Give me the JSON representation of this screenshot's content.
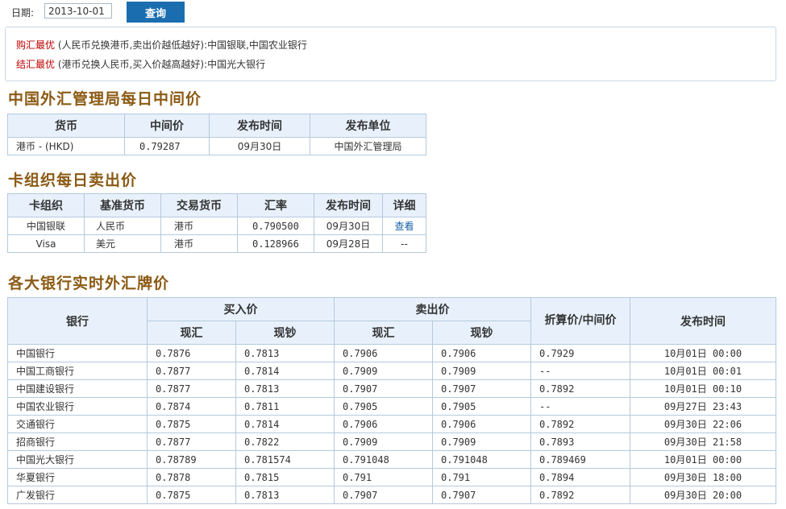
{
  "query": {
    "date_label": "日期:",
    "date_value": "2013-10-01",
    "button_label": "查询"
  },
  "best": {
    "buy_label": "购汇最优",
    "buy_text": "(人民币兑换港币,卖出价越低越好):中国银联,中国农业银行",
    "sell_label": "结汇最优",
    "sell_text": "(港币兑换人民币,买入价越高越好):中国光大银行"
  },
  "safe": {
    "title": "中国外汇管理局每日中间价",
    "headers": [
      "货币",
      "中间价",
      "发布时间",
      "发布单位"
    ],
    "row": [
      "港币 - (HKD)",
      "0.79287",
      "09月30日",
      "中国外汇管理局"
    ]
  },
  "cards": {
    "title": "卡组织每日卖出价",
    "headers": [
      "卡组织",
      "基准货币",
      "交易货币",
      "汇率",
      "发布时间",
      "详细"
    ],
    "rows": [
      [
        "中国银联",
        "人民币",
        "港币",
        "0.790500",
        "09月30日",
        "查看"
      ],
      [
        "Visa",
        "美元",
        "港币",
        "0.128966",
        "09月28日",
        "--"
      ]
    ]
  },
  "banks": {
    "title": "各大银行实时外汇牌价",
    "h_bank": "银行",
    "h_buy": "买入价",
    "h_sell": "卖出价",
    "h_mid": "折算价/中间价",
    "h_time": "发布时间",
    "h_spot": "现汇",
    "h_cash": "现钞",
    "rows": [
      [
        "中国银行",
        "0.7876",
        "0.7813",
        "0.7906",
        "0.7906",
        "0.7929",
        "10月01日 00:00"
      ],
      [
        "中国工商银行",
        "0.7877",
        "0.7814",
        "0.7909",
        "0.7909",
        "--",
        "10月01日 00:01"
      ],
      [
        "中国建设银行",
        "0.7877",
        "0.7813",
        "0.7907",
        "0.7907",
        "0.7892",
        "10月01日 00:10"
      ],
      [
        "中国农业银行",
        "0.7874",
        "0.7811",
        "0.7905",
        "0.7905",
        "--",
        "09月27日 23:43"
      ],
      [
        "交通银行",
        "0.7875",
        "0.7814",
        "0.7906",
        "0.7906",
        "0.7892",
        "09月30日 22:06"
      ],
      [
        "招商银行",
        "0.7877",
        "0.7822",
        "0.7909",
        "0.7909",
        "0.7893",
        "09月30日 21:58"
      ],
      [
        "中国光大银行",
        "0.78789",
        "0.781574",
        "0.791048",
        "0.791048",
        "0.789469",
        "10月01日 00:00"
      ],
      [
        "华夏银行",
        "0.7878",
        "0.7815",
        "0.791",
        "0.791",
        "0.7894",
        "09月30日 18:00"
      ],
      [
        "广发银行",
        "0.7875",
        "0.7813",
        "0.7907",
        "0.7907",
        "0.7892",
        "09月30日 20:00"
      ]
    ]
  }
}
